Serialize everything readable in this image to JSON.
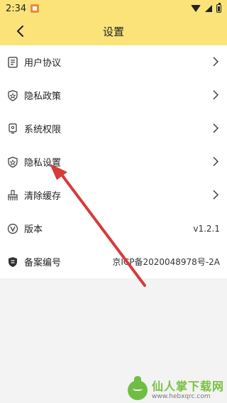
{
  "status": {
    "time": "2:34"
  },
  "header": {
    "title": "设置",
    "back_icon": "back-arrow-icon"
  },
  "settings": [
    {
      "label": "用户协议",
      "icon": "document-icon",
      "type": "chevron"
    },
    {
      "label": "隐私政策",
      "icon": "shield-star-icon",
      "type": "chevron"
    },
    {
      "label": "系统权限",
      "icon": "phone-lock-icon",
      "type": "chevron"
    },
    {
      "label": "隐私设置",
      "icon": "shield-star-icon",
      "type": "chevron"
    },
    {
      "label": "清除缓存",
      "icon": "broom-icon",
      "type": "chevron"
    },
    {
      "label": "版本",
      "icon": "version-v-icon",
      "type": "value",
      "value": "v1.2.1"
    },
    {
      "label": "备案编号",
      "icon": "shield-badge-icon",
      "type": "value",
      "value": "京ICP备2020048978号-2A"
    }
  ],
  "watermark": {
    "main": "仙人掌下载网",
    "sub": "www.hebxqrc.com"
  },
  "colors": {
    "header_bg": "#fbe37a",
    "arrow": "#d83a3a",
    "watermark_green": "#7bc043"
  }
}
